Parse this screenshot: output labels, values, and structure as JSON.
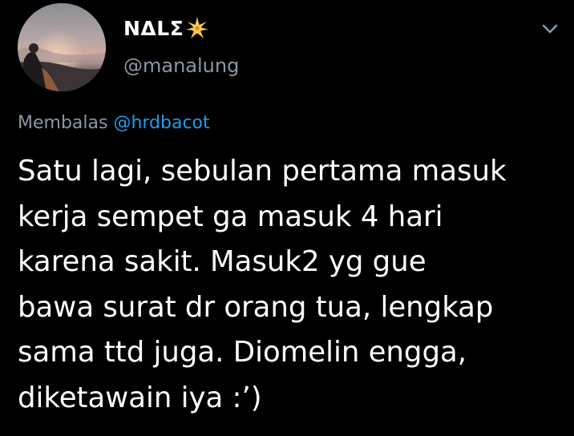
{
  "author": {
    "display_name": "NΔLΣ",
    "name_emoji": "sparkle-star-icon",
    "handle": "@manalung"
  },
  "reply": {
    "prefix": "Membalas",
    "to_handle": "@hrdbacot"
  },
  "tweet": {
    "lines": [
      "Satu lagi, sebulan pertama masuk",
      "kerja sempet ga masuk 4 hari",
      "karena sakit. Masuk2 yg gue",
      "bawa surat dr orang tua, lengkap",
      "sama ttd juga. Diomelin engga,",
      "diketawain iya :’)"
    ]
  },
  "colors": {
    "background": "#000000",
    "text": "#ffffff",
    "secondary": "#8b98a5",
    "link": "#1d9bf0",
    "star": "#f5c542"
  }
}
